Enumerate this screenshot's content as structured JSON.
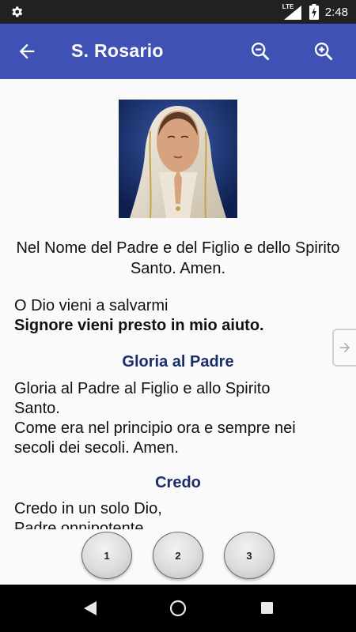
{
  "status_bar": {
    "network": "LTE",
    "time": "2:48",
    "icons": [
      "gear-icon",
      "signal-icon",
      "battery-charging-icon"
    ]
  },
  "app_bar": {
    "title": "S. Rosario",
    "icons": [
      "back-arrow-icon",
      "zoom-out-icon",
      "zoom-in-icon"
    ],
    "color": "#3f51b5"
  },
  "content": {
    "invocation": "Nel Nome del Padre e del Figlio e dello Spirito Santo. Amen.",
    "opening_line": "O Dio vieni a salvarmi",
    "opening_response": "Signore vieni presto in mio aiuto.",
    "gloria_heading": "Gloria al Padre",
    "gloria_line1": "Gloria al Padre al Figlio e allo Spirito Santo.",
    "gloria_line2": "Come era nel principio ora e sempre nei secoli dei secoli. Amen.",
    "credo_heading": "Credo",
    "credo_line1": "Credo in un solo Dio,",
    "credo_line2": "Padre onnipotente,",
    "heading_color": "#1a2d6b"
  },
  "buttons": [
    "1",
    "2",
    "3"
  ],
  "nav_bar": {
    "icons": [
      "nav-back-icon",
      "nav-home-icon",
      "nav-recent-icon"
    ]
  }
}
